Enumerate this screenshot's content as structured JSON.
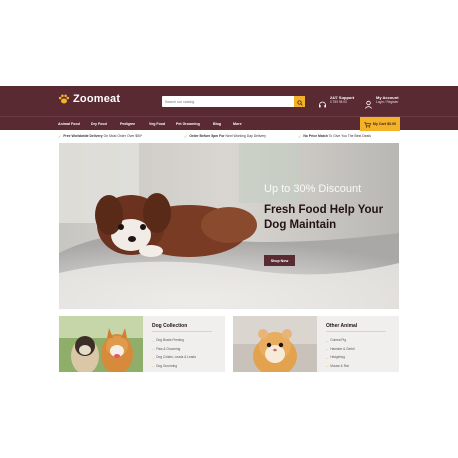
{
  "brand": {
    "name": "Zoomeat"
  },
  "search": {
    "placeholder": "Search our catalog"
  },
  "support": {
    "title": "24/7 Support",
    "sub": "0 789 98 00"
  },
  "account": {
    "title": "My Account",
    "sub": "Login / Register"
  },
  "nav": {
    "items": [
      "Animal Food",
      "Dry Food",
      "Pedigree",
      "Veg Food",
      "Pet Grooming",
      "Blog",
      "More"
    ]
  },
  "cart": {
    "label": "My Cart $0.00",
    "count": "0"
  },
  "promo": [
    {
      "strong": "Free Worldwide Delivery",
      "rest": " On Most Order Over $50*"
    },
    {
      "strong": "Order Before 5pm For",
      "rest": " Next Working Day Delivery"
    },
    {
      "strong": "No Price Match",
      "rest": " To Give You The Best Deals"
    }
  ],
  "banner": {
    "subtitle": "Up to 30% Discount",
    "title": "Fresh Food Help Your Dog Maintain",
    "button": "Shop Now"
  },
  "cards": [
    {
      "title": "Dog Collection",
      "items": [
        "Dog Bowls Feeding",
        "Flea & Grooming",
        "Dog Collars, Leads & Leads",
        "Dog Grooming"
      ]
    },
    {
      "title": "Other Animal",
      "items": [
        "Guinea Pig",
        "Hamster & Gerbil",
        "Hedgehog",
        "Mouse & Rat"
      ]
    }
  ],
  "colors": {
    "brand": "#5a2a32",
    "accent": "#f2b32a"
  }
}
